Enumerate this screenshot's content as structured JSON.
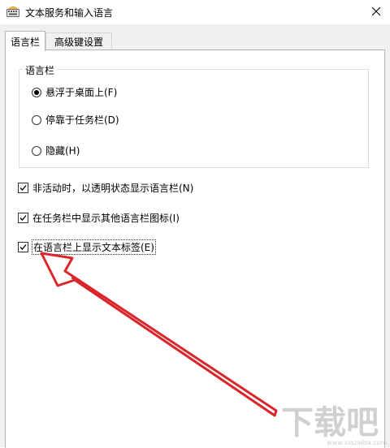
{
  "window": {
    "title": "文本服务和输入语言",
    "close_glyph": "✕"
  },
  "tabs": [
    {
      "label": "语言栏",
      "active": true
    },
    {
      "label": "高级键设置",
      "active": false
    }
  ],
  "language_bar_group": {
    "legend": "语言栏",
    "options": [
      {
        "label": "悬浮于桌面上(F)",
        "checked": true
      },
      {
        "label": "停靠于任务栏(D)",
        "checked": false
      },
      {
        "label": "隐藏(H)",
        "checked": false
      }
    ]
  },
  "checkboxes": [
    {
      "label": "非活动时，以透明状态显示语言栏(N)",
      "checked": true
    },
    {
      "label": "在任务栏中显示其他语言栏图标(I)",
      "checked": true
    },
    {
      "label": "在语言栏上显示文本标签(E)",
      "checked": true
    }
  ],
  "colors": {
    "annotation_arrow": "#d9262b",
    "watermark": "#c8c8c8"
  },
  "watermark": {
    "main_text": "下载吧",
    "sub_text": "www.xiazaiba.com"
  }
}
